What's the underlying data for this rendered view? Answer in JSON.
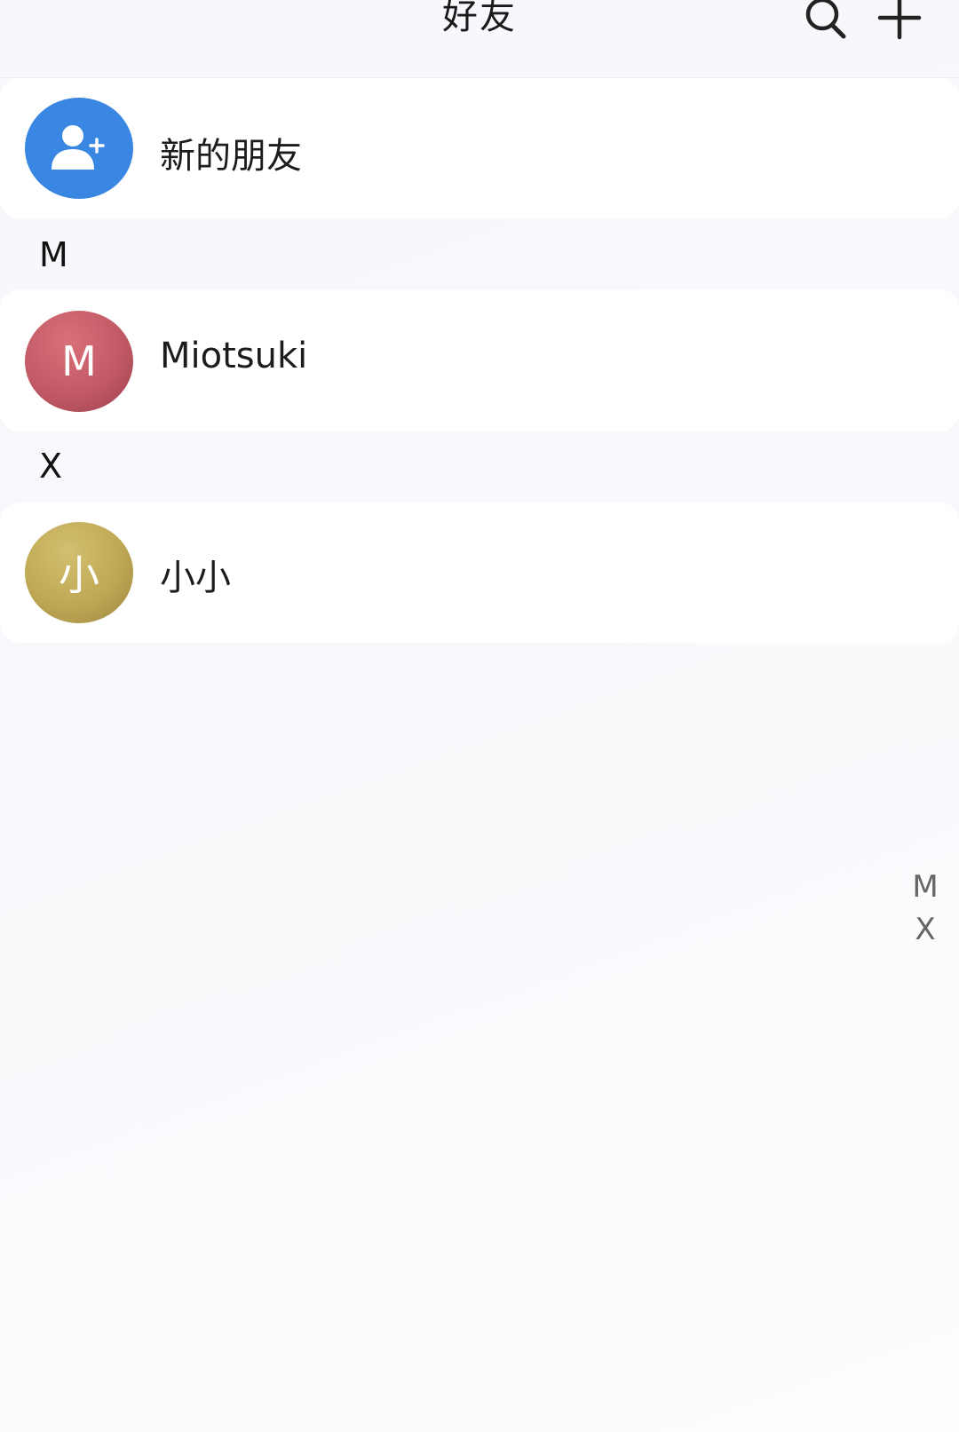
{
  "header": {
    "title": "好友",
    "search_icon": "search-icon",
    "add_icon": "plus-icon"
  },
  "new_friends": {
    "label": "新的朋友",
    "icon": "add-user-icon",
    "avatar_color": "#3a86e3"
  },
  "sections": [
    {
      "letter": "M",
      "contacts": [
        {
          "name": "Miotsuki",
          "avatar_text": "M",
          "avatar_color": "#c25a66"
        }
      ]
    },
    {
      "letter": "X",
      "contacts": [
        {
          "name": "小小",
          "avatar_text": "小",
          "avatar_color": "#bfa855"
        }
      ]
    }
  ],
  "index_bar": [
    "M",
    "X"
  ]
}
